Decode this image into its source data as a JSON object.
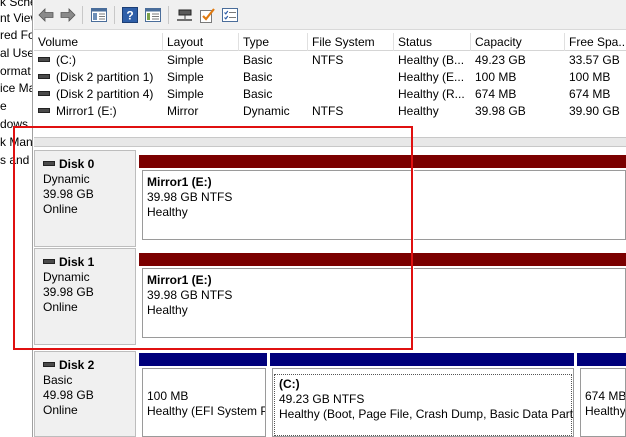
{
  "tree": {
    "items": [
      "k Sche",
      "nt View",
      "red Fo",
      "al Use",
      "ormat",
      "ice Ma",
      "e",
      "dows",
      "k Mana",
      "s and A"
    ]
  },
  "toolbar": {
    "icons": [
      "back-arrow-icon",
      "forward-arrow-icon",
      "show-hide-console-tree-icon",
      "help-icon",
      "properties-icon",
      "connect-icon",
      "check-disk-icon",
      "settings-list-icon"
    ]
  },
  "volume_list": {
    "columns": [
      "Volume",
      "Layout",
      "Type",
      "File System",
      "Status",
      "Capacity",
      "Free Spa..."
    ],
    "rows": [
      [
        "(C:)",
        "Simple",
        "Basic",
        "NTFS",
        "Healthy (B...",
        "49.23 GB",
        "33.57 GB"
      ],
      [
        "(Disk 2 partition 1)",
        "Simple",
        "Basic",
        "",
        "Healthy (E...",
        "100 MB",
        "100 MB"
      ],
      [
        "(Disk 2 partition 4)",
        "Simple",
        "Basic",
        "",
        "Healthy (R...",
        "674 MB",
        "674 MB"
      ],
      [
        "Mirror1 (E:)",
        "Mirror",
        "Dynamic",
        "NTFS",
        "Healthy",
        "39.98 GB",
        "39.90 GB"
      ]
    ]
  },
  "disks": [
    {
      "name": "Disk 0",
      "type": "Dynamic",
      "size": "39.98 GB",
      "status": "Online",
      "partitions": [
        {
          "title": "Mirror1  (E:)",
          "size_fs": "39.98 GB NTFS",
          "status": "Healthy",
          "color": "#7b0000"
        }
      ]
    },
    {
      "name": "Disk 1",
      "type": "Dynamic",
      "size": "39.98 GB",
      "status": "Online",
      "partitions": [
        {
          "title": "Mirror1  (E:)",
          "size_fs": "39.98 GB NTFS",
          "status": "Healthy",
          "color": "#7b0000"
        }
      ]
    },
    {
      "name": "Disk 2",
      "type": "Basic",
      "size": "49.98 GB",
      "status": "Online",
      "partitions": [
        {
          "title": "",
          "size_fs": "100 MB",
          "status": "Healthy (EFI System P",
          "color": "#00007b"
        },
        {
          "title": "(C:)",
          "size_fs": "49.23 GB NTFS",
          "status": "Healthy (Boot, Page File, Crash Dump, Basic Data Partiti",
          "color": "#00007b"
        },
        {
          "title": "",
          "size_fs": "674 MB",
          "status": "Healthy",
          "color": "#00007b"
        }
      ]
    }
  ],
  "colors": {
    "mirror_bar": "#7b0000",
    "primary_bar": "#00007b",
    "highlight_border": "#e01010"
  }
}
